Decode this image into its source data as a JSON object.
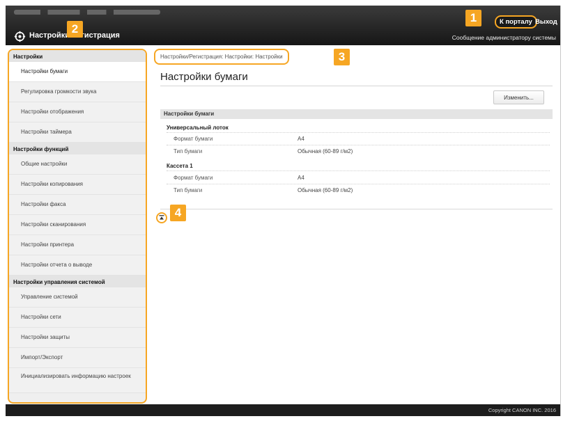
{
  "header": {
    "app_title": "Настройки/Регистрация",
    "portal_link": "К порталу",
    "logout_link": "Выход",
    "admin_message": "Сообщение администратору системы",
    "logo_icon": "gear-icon"
  },
  "sidebar": {
    "groups": [
      {
        "title": "Настройки",
        "items": [
          "Настройки бумаги",
          "Регулировка громкости звука",
          "Настройки отображения",
          "Настройки таймера"
        ]
      },
      {
        "title": "Настройки функций",
        "items": [
          "Общие настройки",
          "Настройки копирования",
          "Настройки факса",
          "Настройки сканирования",
          "Настройки принтера",
          "Настройки отчета о выводе"
        ]
      },
      {
        "title": "Настройки управления системой",
        "items": [
          "Управление системой",
          "Настройки сети",
          "Настройки защиты",
          "Импорт/Экспорт",
          "Инициализировать информацию настроек"
        ]
      }
    ],
    "active_item": "Настройки бумаги"
  },
  "main": {
    "breadcrumb": "Настройки/Регистрация: Настройки: Настройки",
    "page_title": "Настройки бумаги",
    "edit_button": "Изменить...",
    "section_title": "Настройки бумаги",
    "sources": [
      {
        "name": "Универсальный лоток",
        "rows": [
          {
            "label": "Формат бумаги",
            "value": "A4"
          },
          {
            "label": "Тип бумаги",
            "value": "Обычная (60-89 г/м2)"
          }
        ]
      },
      {
        "name": "Кассета 1",
        "rows": [
          {
            "label": "Формат бумаги",
            "value": "A4"
          },
          {
            "label": "Тип бумаги",
            "value": "Обычная (60-89 г/м2)"
          }
        ]
      }
    ]
  },
  "footer": {
    "copyright": "Copyright CANON INC. 2016"
  },
  "callouts": [
    "1",
    "2",
    "3",
    "4"
  ],
  "colors": {
    "accent": "#f6a623",
    "topbar": "#1a1a1a",
    "sidebar_bg": "#efefef"
  }
}
